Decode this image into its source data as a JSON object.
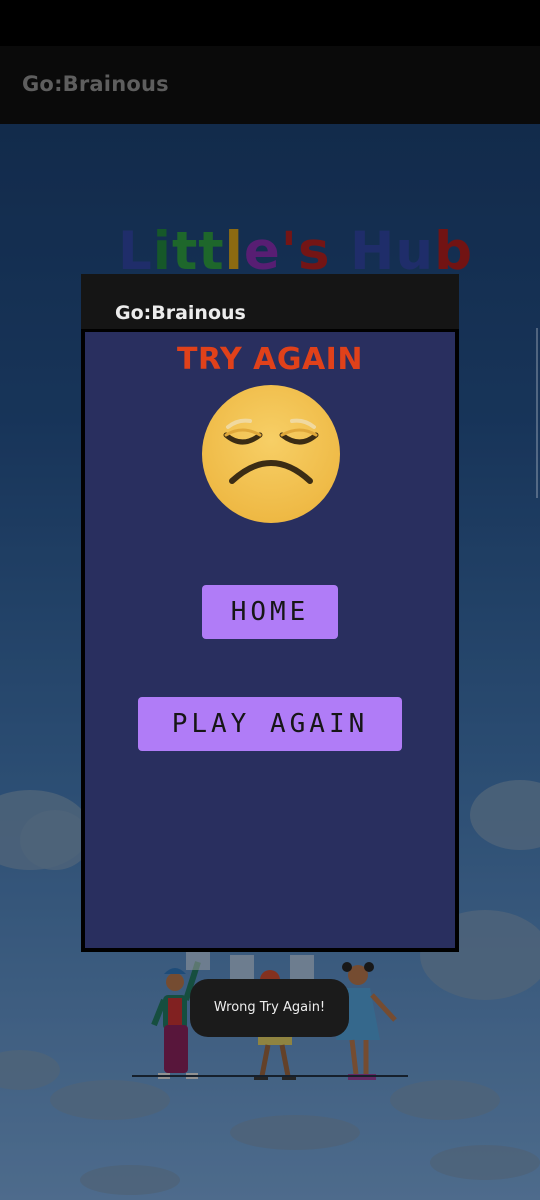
{
  "app": {
    "title": "Go:Brainous"
  },
  "background": {
    "logo_letters": [
      {
        "char": "L",
        "color": "#2c3f93"
      },
      {
        "char": "i",
        "color": "#1f7a3a"
      },
      {
        "char": "t",
        "color": "#2a8f3c"
      },
      {
        "char": "t",
        "color": "#2a8f3c"
      },
      {
        "char": "l",
        "color": "#c29418"
      },
      {
        "char": "e",
        "color": "#7a2aa0"
      },
      {
        "char": "'",
        "color": "#a11e1e"
      },
      {
        "char": "s",
        "color": "#a11e1e"
      },
      {
        "char": " ",
        "color": "#000000"
      },
      {
        "char": "H",
        "color": "#2c3f93"
      },
      {
        "char": "u",
        "color": "#2c3f93"
      },
      {
        "char": "b",
        "color": "#9f1b1b"
      }
    ]
  },
  "dialog": {
    "header_title": "Go:Brainous",
    "heading": "TRY AGAIN",
    "emoji": "sad-face-icon",
    "home_label": "HOME",
    "play_again_label": "PLAY AGAIN"
  },
  "toast": {
    "message": "Wrong Try Again!"
  },
  "colors": {
    "heading": "#e0411a",
    "button": "#b07cf7",
    "dialog_body": "#292f5f",
    "emoji_face": "#f3c455"
  }
}
